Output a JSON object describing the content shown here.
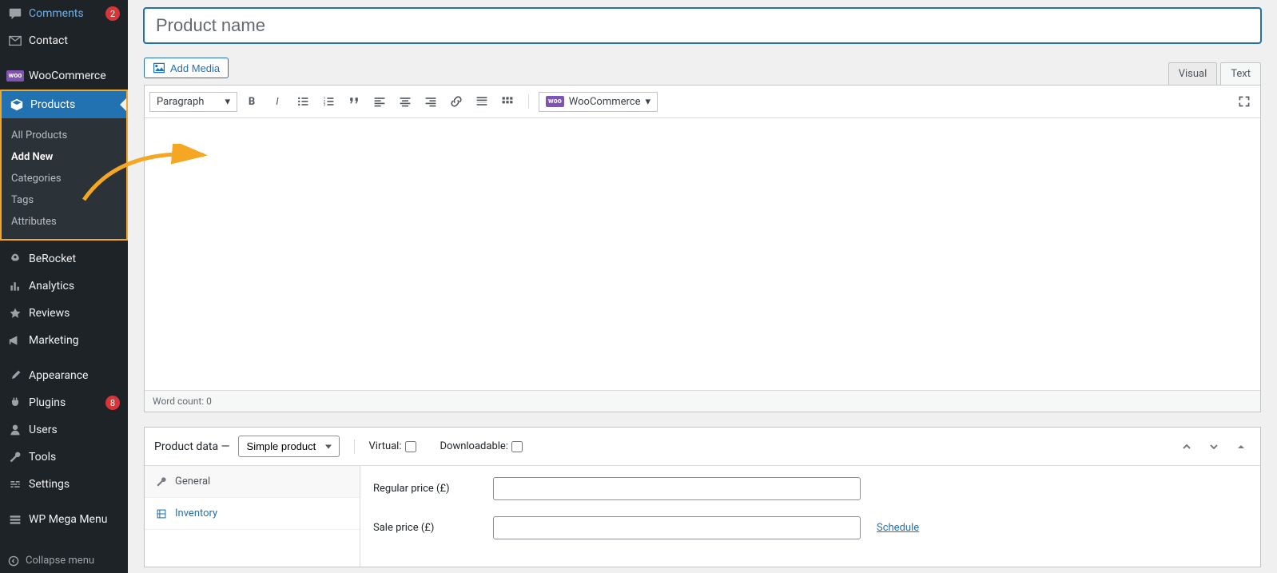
{
  "sidebar": {
    "comments": "Comments",
    "comments_count": "2",
    "contact": "Contact",
    "woocommerce": "WooCommerce",
    "products": "Products",
    "submenu": {
      "all": "All Products",
      "add": "Add New",
      "cats": "Categories",
      "tags": "Tags",
      "attrs": "Attributes"
    },
    "berocket": "BeRocket",
    "analytics": "Analytics",
    "reviews": "Reviews",
    "marketing": "Marketing",
    "appearance": "Appearance",
    "plugins": "Plugins",
    "plugins_count": "8",
    "users": "Users",
    "tools": "Tools",
    "settings": "Settings",
    "megamenu": "WP Mega Menu",
    "collapse": "Collapse menu"
  },
  "title_placeholder": "Product name",
  "editor": {
    "add_media": "Add Media",
    "visual": "Visual",
    "text": "Text",
    "paragraph": "Paragraph",
    "woo_btn": "WooCommerce",
    "word_count_label": "Word count: 0"
  },
  "panel": {
    "title": "Product data",
    "dash": " — ",
    "type": "Simple product",
    "virtual": "Virtual:",
    "downloadable": "Downloadable:",
    "tab_general": "General",
    "tab_inventory": "Inventory",
    "reg_price": "Regular price (£)",
    "sale_price": "Sale price (£)",
    "schedule": "Schedule"
  }
}
